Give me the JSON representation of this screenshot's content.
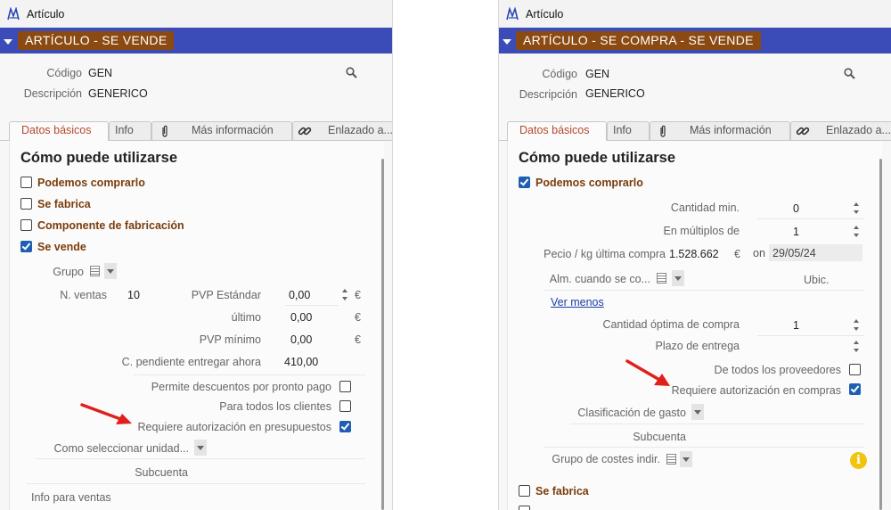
{
  "colors": {
    "header_blue": "#3b4cb8",
    "header_brown": "#8b4a12",
    "label_brown": "#7a3d0c",
    "active_tab": "#b5482b",
    "checkbox_blue": "#1e5fb3",
    "arrow_red": "#e0201b",
    "info_yellow": "#f1c40f"
  },
  "icons": {
    "app": "app-logo-icon",
    "search": "magnifier-icon",
    "attachment": "paperclip-icon",
    "link": "chain-link-icon",
    "list": "list-icon",
    "dropdown": "chevron-down-icon",
    "spinner": "spinner-arrows-icon",
    "info": "info-icon"
  },
  "left": {
    "window_title": "Artículo",
    "header_title": "ARTÍCULO - SE VENDE",
    "codigo_label": "Código",
    "codigo_value": "GEN",
    "descripcion_label": "Descripción",
    "descripcion_value": "GENERICO",
    "tabs": {
      "datos": "Datos básicos",
      "info": "Info",
      "mas": "Más información",
      "enlazado": "Enlazado a..."
    },
    "section_title": "Cómo puede utilizarse",
    "checks": {
      "podemos_comprarlo": "Podemos comprarlo",
      "se_fabrica": "Se fabrica",
      "componente": "Componente de fabricación",
      "se_vende": "Se vende"
    },
    "grupo_label": "Grupo",
    "n_ventas_label": "N. ventas",
    "n_ventas_value": "10",
    "pvp_estandar_label": "PVP Estándar",
    "pvp_estandar_value": "0,00",
    "ultimo_label": "último",
    "ultimo_value": "0,00",
    "pvp_minimo_label": "PVP mínimo",
    "pvp_minimo_value": "0,00",
    "currency": "€",
    "pendiente_label": "C. pendiente entregar ahora",
    "pendiente_value": "410,00",
    "permite_desc_label": "Permite descuentos por pronto pago",
    "todos_clientes_label": "Para todos los clientes",
    "requiere_presupuestos_label": "Requiere autorización en presupuestos",
    "como_seleccionar_label": "Como seleccionar unidad...",
    "subcuenta_label": "Subcuenta",
    "info_ventas_label": "Info para ventas"
  },
  "right": {
    "window_title": "Artículo",
    "header_title": "ARTÍCULO - SE COMPRA - SE VENDE",
    "codigo_label": "Código",
    "codigo_value": "GEN",
    "descripcion_label": "Descripción",
    "descripcion_value": "GENERICO",
    "tabs": {
      "datos": "Datos básicos",
      "info": "Info",
      "mas": "Más información",
      "enlazado": "Enlazado a..."
    },
    "section_title": "Cómo puede utilizarse",
    "podemos_comprarlo": "Podemos comprarlo",
    "cantidad_min_label": "Cantidad min.",
    "cantidad_min_value": "0",
    "multiplos_label": "En múltiplos de",
    "multiplos_value": "1",
    "precio_label": "Pecio / kg última compra",
    "precio_value": "1.528.662",
    "currency": "€",
    "on_label": "on",
    "fecha_value": "29/05/24",
    "alm_label": "Alm. cuando se co...",
    "ubic_label": "Ubic.",
    "ver_menos": "Ver menos",
    "cantidad_optima_label": "Cantidad óptima de compra",
    "cantidad_optima_value": "1",
    "plazo_label": "Plazo de entrega",
    "todos_proveedores_label": "De todos los proveedores",
    "requiere_compras_label": "Requiere autorización en compras",
    "clasificacion_label": "Clasificación de gasto",
    "subcuenta_label": "Subcuenta",
    "grupo_costes_label": "Grupo de costes indir.",
    "info_glyph": "i",
    "se_fabrica": "Se fabrica"
  }
}
